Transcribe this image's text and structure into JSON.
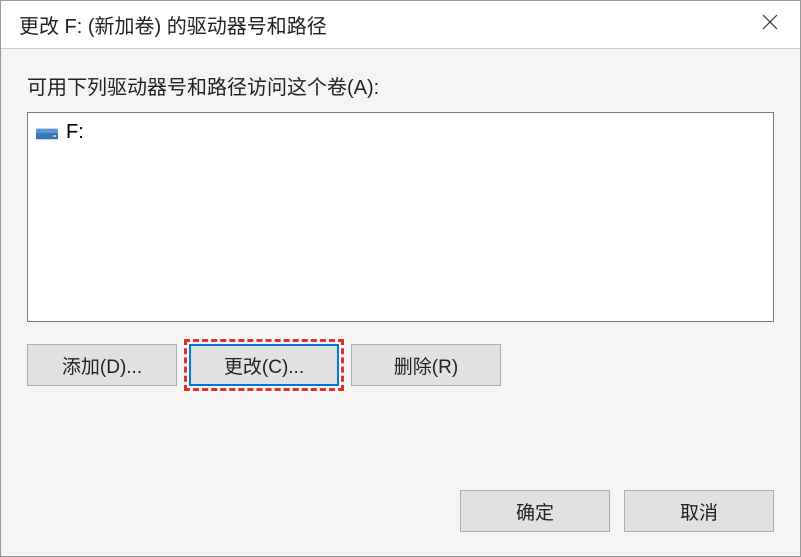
{
  "titlebar": {
    "title": "更改 F: (新加卷) 的驱动器号和路径"
  },
  "instruction": "可用下列驱动器号和路径访问这个卷(A):",
  "list": {
    "items": [
      {
        "label": "F:"
      }
    ]
  },
  "buttons": {
    "add": "添加(D)...",
    "change": "更改(C)...",
    "remove": "删除(R)"
  },
  "footer": {
    "ok": "确定",
    "cancel": "取消"
  }
}
